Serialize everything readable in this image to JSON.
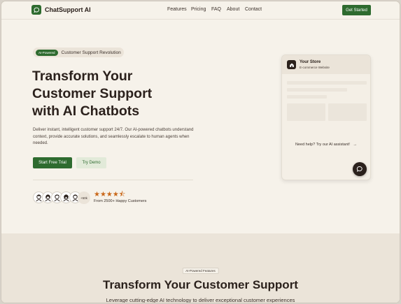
{
  "nav": {
    "brand": "ChatSupport AI",
    "logo_icon": "chat-bubble-icon",
    "links": [
      "Features",
      "Pricing",
      "FAQ",
      "About",
      "Contact"
    ],
    "cta": "Get Started"
  },
  "hero": {
    "badge_pill": "AI-Powered",
    "badge_text": "Customer Support Revolution",
    "title_lines": [
      "Transform Your",
      "Customer Support",
      "with AI Chatbots"
    ],
    "description": "Deliver instant, intelligent customer support 24/7. Our AI-powered chatbots understand context, provide accurate solutions, and seamlessly escalate to human agents when needed.",
    "primary_cta": "Start Free Trial",
    "secondary_cta": "Try Demo",
    "avatar_count": "+50k",
    "rating": 4.5,
    "stars": "★★★★⯪",
    "customers": "From 2500+ Happy Customers"
  },
  "chat_card": {
    "store_name": "Your Store",
    "store_sub": "E-commerce Website",
    "store_icon": "house-icon",
    "help_text": "Need help? Try our AI assistant!",
    "arrow": "→",
    "chat_icon": "chat-bubble-icon"
  },
  "features": {
    "badge": "AI-Powered Features",
    "title": "Transform Your Customer Support",
    "subtitle": "Leverage cutting-edge AI technology to deliver exceptional customer experiences"
  },
  "colors": {
    "accent": "#2e6b2f",
    "background": "#f6f2ea",
    "dark": "#2b211c",
    "star": "#c9681a"
  }
}
